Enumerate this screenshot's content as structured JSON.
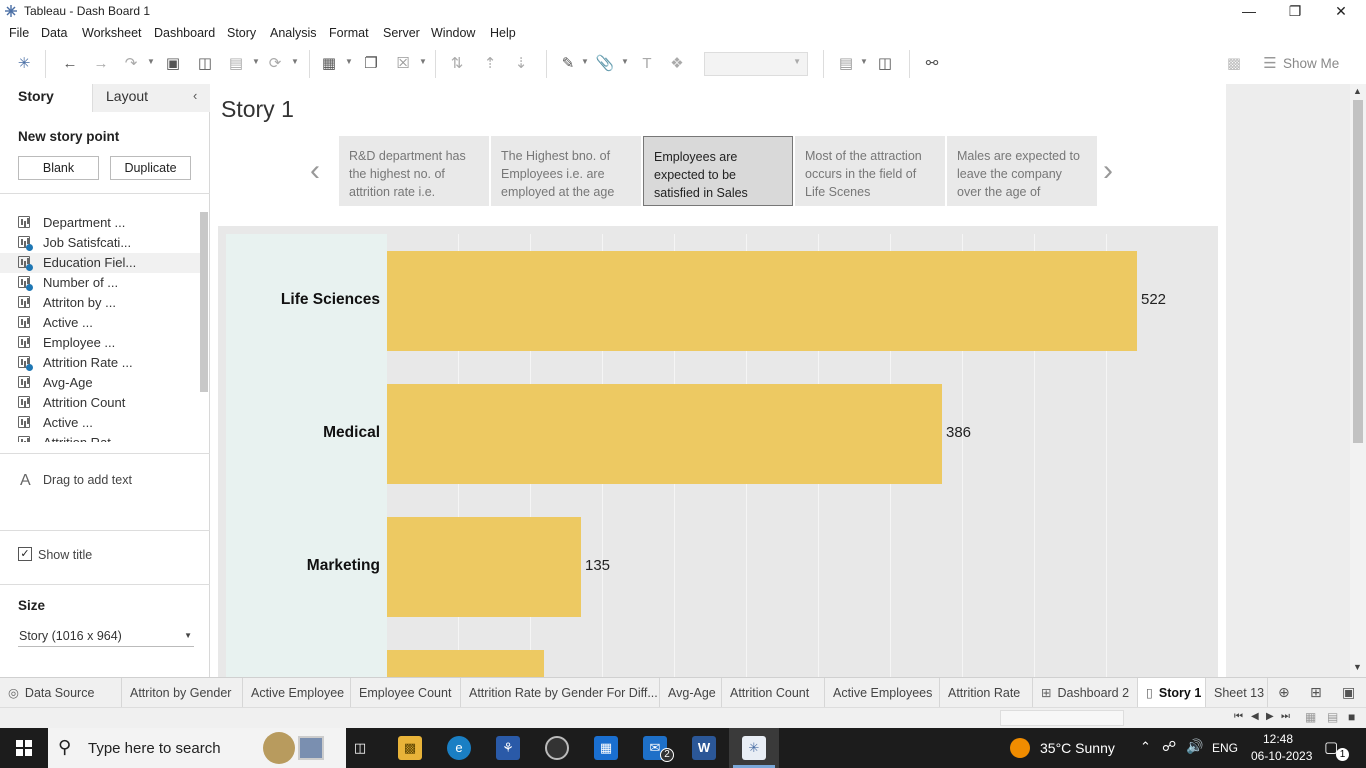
{
  "window": {
    "title": "Tableau - Dash Board 1"
  },
  "menu": [
    "File",
    "Data",
    "Worksheet",
    "Dashboard",
    "Story",
    "Analysis",
    "Format",
    "Server",
    "Window",
    "Help"
  ],
  "toolbar": {
    "show_me": "Show Me"
  },
  "left_panel": {
    "tab_story": "Story",
    "tab_layout": "Layout",
    "new_story_point": "New story point",
    "blank_button": "Blank",
    "duplicate_button": "Duplicate",
    "sheets": [
      {
        "label": "Department ...",
        "used": false
      },
      {
        "label": "Job Satisfcati...",
        "used": true
      },
      {
        "label": "Education Fiel...",
        "used": true
      },
      {
        "label": "Number of ...",
        "used": true
      },
      {
        "label": "Attriton by ...",
        "used": false
      },
      {
        "label": "Active ...",
        "used": false
      },
      {
        "label": "Employee  ...",
        "used": false
      },
      {
        "label": "Attrition Rate ...",
        "used": true
      },
      {
        "label": "Avg-Age",
        "used": false
      },
      {
        "label": "Attrition Count",
        "used": false
      },
      {
        "label": "Active ...",
        "used": false
      },
      {
        "label": "Attrition Rat...",
        "used": false
      }
    ],
    "drag_text": "Drag to add text",
    "show_title": "Show title",
    "size_heading": "Size",
    "size_value": "Story (1016 x 964)"
  },
  "story": {
    "title": "Story 1",
    "points": [
      {
        "text": "R&D department has the highest no. of attrition rate i.e."
      },
      {
        "text": "The Highest bno. of Employees i.e. are employed at the age"
      },
      {
        "text": "Employees are expected to be satisfied in Sales"
      },
      {
        "text": "Most  of the attraction occurs in the field of Life Scenes"
      },
      {
        "text": "Males are expected to leave the company over the age of"
      }
    ],
    "active_index": 2
  },
  "chart_data": {
    "type": "bar",
    "orientation": "horizontal",
    "categories": [
      "Life Sciences",
      "Medical",
      "Marketing"
    ],
    "values": [
      522,
      386,
      135
    ],
    "partial_bar_visible": true,
    "grid": true,
    "color": "#edc962"
  },
  "tabs": [
    {
      "label": "Data Source",
      "active": false
    },
    {
      "label": "Attriton by Gender",
      "active": false
    },
    {
      "label": "Active Employee",
      "active": false
    },
    {
      "label": "Employee  Count",
      "active": false
    },
    {
      "label": "Attrition Rate by Gender For Diff...",
      "active": false
    },
    {
      "label": "Avg-Age",
      "active": false
    },
    {
      "label": "Attrition Count",
      "active": false
    },
    {
      "label": "Active Employees",
      "active": false
    },
    {
      "label": "Attrition Rate",
      "active": false
    },
    {
      "label": "Dashboard 2",
      "active": false
    },
    {
      "label": "Story 1",
      "active": true
    },
    {
      "label": "Sheet 13",
      "active": false
    }
  ],
  "taskbar": {
    "search_placeholder": "Type here to search",
    "weather": "35°C  Sunny",
    "language": "ENG",
    "time": "12:48",
    "date": "06-10-2023",
    "mail_badge": "2",
    "notif_badge": "1"
  }
}
